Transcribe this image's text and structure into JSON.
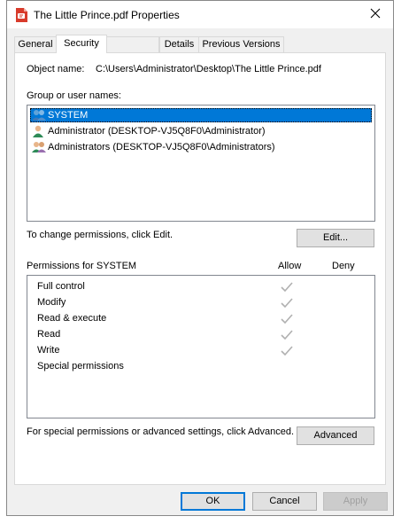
{
  "window": {
    "title": "The Little Prince.pdf Properties"
  },
  "tabs": [
    {
      "label": "General"
    },
    {
      "label": "Security"
    },
    {
      "label": "Details"
    },
    {
      "label": "Previous Versions"
    }
  ],
  "object": {
    "label": "Object name:",
    "value": "C:\\Users\\Administrator\\Desktop\\The Little Prince.pdf"
  },
  "group": {
    "label": "Group or user names:",
    "users": [
      {
        "name": "SYSTEM",
        "icon": "group-users-icon"
      },
      {
        "name": "Administrator (DESKTOP-VJ5Q8F0\\Administrator)",
        "icon": "user-icon"
      },
      {
        "name": "Administrators (DESKTOP-VJ5Q8F0\\Administrators)",
        "icon": "group-users-icon"
      }
    ]
  },
  "change_text": "To change permissions, click Edit.",
  "edit_button": "Edit...",
  "permissions": {
    "header": "Permissions for SYSTEM",
    "allow_label": "Allow",
    "deny_label": "Deny",
    "rows": [
      {
        "name": "Full control",
        "allow": true,
        "deny": false
      },
      {
        "name": "Modify",
        "allow": true,
        "deny": false
      },
      {
        "name": "Read & execute",
        "allow": true,
        "deny": false
      },
      {
        "name": "Read",
        "allow": true,
        "deny": false
      },
      {
        "name": "Write",
        "allow": true,
        "deny": false
      },
      {
        "name": "Special permissions",
        "allow": false,
        "deny": false
      }
    ]
  },
  "advanced_text": "For special permissions or advanced settings, click Advanced.",
  "advanced_button": "Advanced",
  "footer": {
    "ok": "OK",
    "cancel": "Cancel",
    "apply": "Apply"
  },
  "colors": {
    "selection": "#0078d7",
    "check": "#b0b0b0",
    "pdf_icon": "#d83b2b"
  }
}
